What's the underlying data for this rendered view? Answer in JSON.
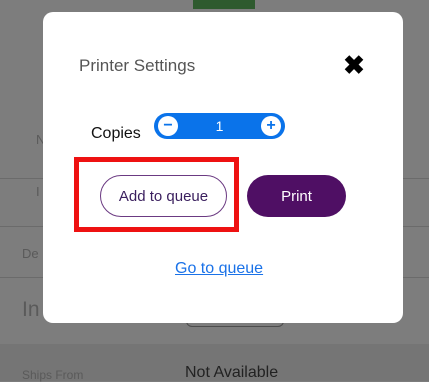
{
  "background": {
    "labels": [
      "N",
      "I",
      "De",
      "In"
    ],
    "ships_from_label": "Ships From",
    "ships_from_value": "Not Available"
  },
  "modal": {
    "title": "Printer Settings",
    "close_icon": "close-x-icon",
    "copies": {
      "label": "Copies",
      "value": "1",
      "minus_icon": "minus-icon",
      "plus_icon": "plus-icon"
    },
    "buttons": {
      "add_to_queue": "Add to queue",
      "print": "Print"
    },
    "go_to_queue_link": "Go to queue"
  },
  "colors": {
    "stepper": "#0a73ea",
    "print_button": "#4f0f64",
    "highlight": "#ee1111",
    "link": "#1a72e8"
  }
}
